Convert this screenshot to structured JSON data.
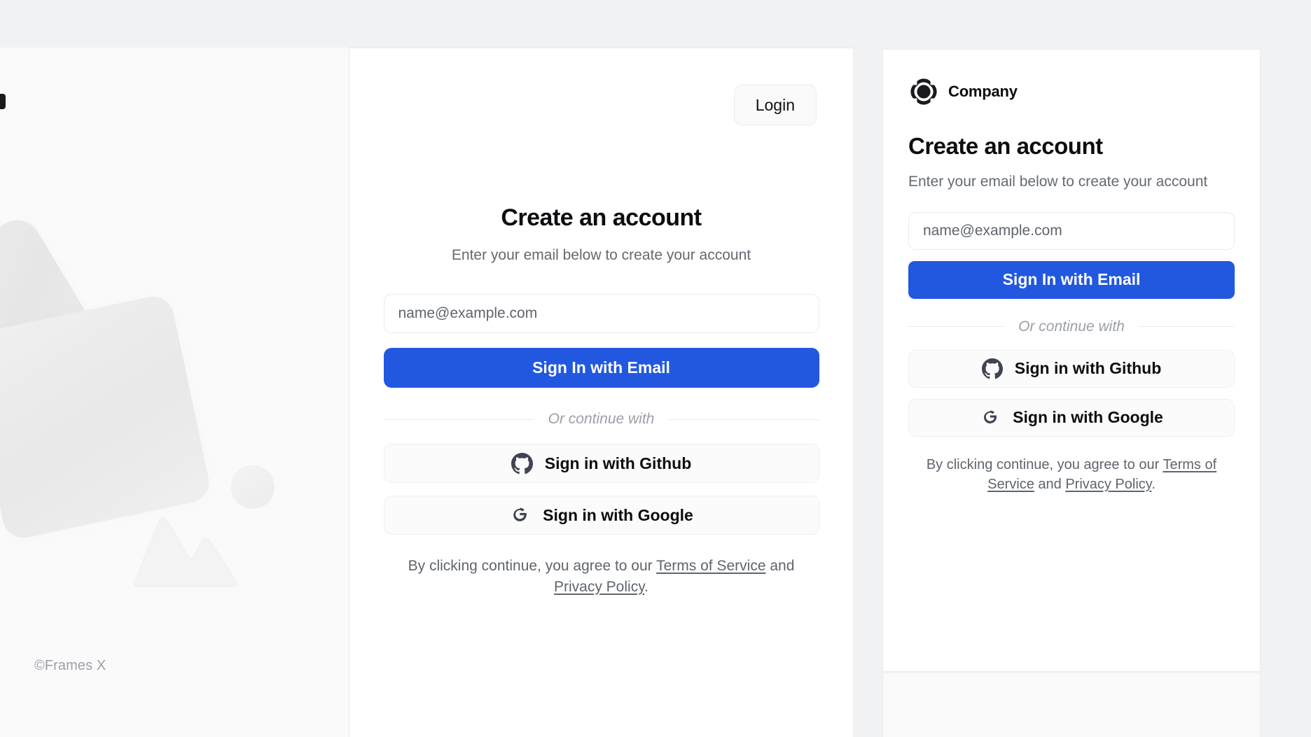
{
  "app": {
    "background_color": "#f1f2f4",
    "accent_color": "#2258e0"
  },
  "left_panel": {
    "footer_text": "©Frames X",
    "decorations": [
      {
        "name": "rounded-square-large",
        "color": "#e9e9ea"
      },
      {
        "name": "rounded-square-small",
        "color": "#eeeeef"
      },
      {
        "name": "circle",
        "color": "#f0f0f1"
      },
      {
        "name": "mountain-triangle",
        "color": "#f2f2f3"
      }
    ]
  },
  "center_panel": {
    "login_label": "Login",
    "title": "Create an account",
    "subtitle": "Enter your email below to create your account",
    "email_placeholder": "name@example.com",
    "email_value": "",
    "primary_button": "Sign In with Email",
    "divider_label": "Or continue with",
    "github_button": "Sign in with Github",
    "google_button": "Sign in with Google",
    "terms": {
      "prefix": "By clicking continue, you agree to our ",
      "terms_link": "Terms of Service",
      "middle": " and ",
      "privacy_link": "Privacy Policy",
      "suffix": "."
    }
  },
  "right_card": {
    "brand_name": "Company",
    "brand_logo_icon": "company-flower-logo-icon",
    "title": "Create an account",
    "subtitle": "Enter your email below to create your account",
    "email_placeholder": "name@example.com",
    "email_value": "",
    "primary_button": "Sign In with Email",
    "divider_label": "Or continue with",
    "github_button": "Sign in with Github",
    "google_button": "Sign in with Google",
    "terms": {
      "prefix": "By clicking continue, you agree to our ",
      "terms_link": "Terms of Service",
      "middle": " and ",
      "privacy_link": "Privacy Policy",
      "suffix": "."
    }
  },
  "icons": {
    "github": "github-icon",
    "google": "google-icon"
  }
}
